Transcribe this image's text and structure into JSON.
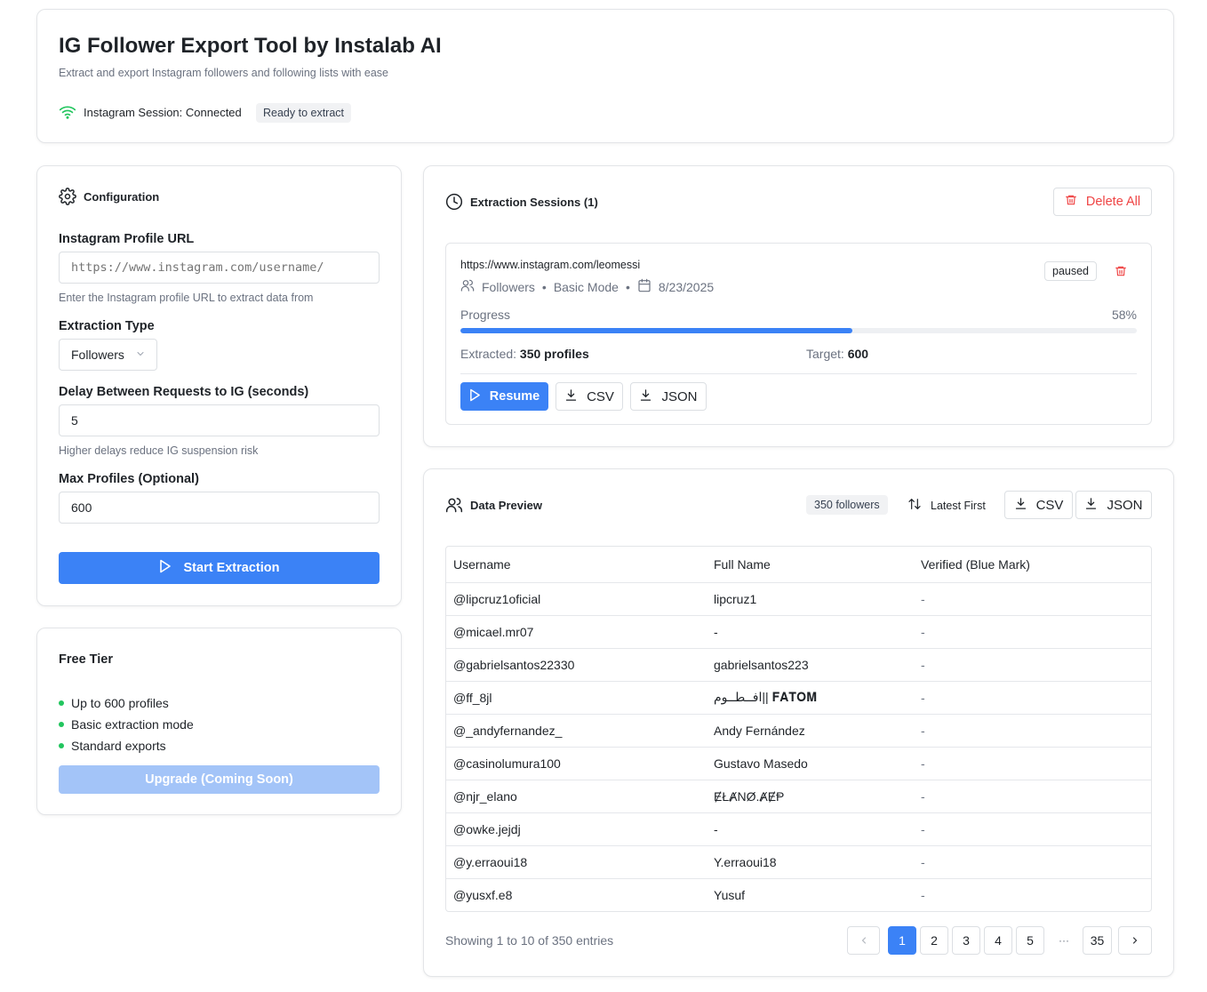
{
  "header": {
    "title": "IG Follower Export Tool by Instalab AI",
    "subtitle": "Extract and export Instagram followers and following lists with ease",
    "session_status": "Instagram Session: Connected",
    "ready_badge": "Ready to extract",
    "status_color": "#22c55e"
  },
  "config": {
    "title": "Configuration",
    "url_label": "Instagram Profile URL",
    "url_placeholder": "https://www.instagram.com/username/",
    "url_help": "Enter the Instagram profile URL to extract data from",
    "type_label": "Extraction Type",
    "type_value": "Followers",
    "delay_label": "Delay Between Requests to IG (seconds)",
    "delay_value": "5",
    "delay_help": "Higher delays reduce IG suspension risk",
    "max_label": "Max Profiles (Optional)",
    "max_value": "600",
    "start_button": "Start Extraction",
    "accent": "#3b82f6"
  },
  "free_tier": {
    "title": "Free Tier",
    "features": [
      "Up to 600 profiles",
      "Basic extraction mode",
      "Standard exports"
    ],
    "upgrade_button": "Upgrade (Coming Soon)"
  },
  "sessions": {
    "title": "Extraction Sessions (1)",
    "delete_all": "Delete All",
    "item": {
      "url": "https://www.instagram.com/leomessi",
      "type": "Followers",
      "mode": "Basic Mode",
      "date": "8/23/2025",
      "status": "paused",
      "progress_label": "Progress",
      "progress_percent": "58%",
      "progress_value": 0.58,
      "extracted_label": "Extracted:",
      "extracted_value": "350 profiles",
      "target_label": "Target:",
      "target_value": "600",
      "resume_button": "Resume",
      "csv_button": "CSV",
      "json_button": "JSON"
    }
  },
  "preview": {
    "title": "Data Preview",
    "count_badge": "350 followers",
    "sort_label": "Latest First",
    "csv_button": "CSV",
    "json_button": "JSON",
    "columns": [
      "Username",
      "Full Name",
      "Verified (Blue Mark)"
    ],
    "rows": [
      [
        "@lipcruz1oficial",
        "lipcruz1",
        "-"
      ],
      [
        "@micael.mr07",
        "-",
        "-"
      ],
      [
        "@gabrielsantos22330",
        "gabrielsantos223",
        "-"
      ],
      [
        "@ff_8jl",
        "افــطــوم|| 𝐅𝐀𝐓𝐎𝐌",
        "-"
      ],
      [
        "@_andyfernandez_",
        "Andy Fernández",
        "-"
      ],
      [
        "@casinolumura100",
        "Gustavo Masedo",
        "-"
      ],
      [
        "@njr_elano",
        "ɆŁȺNØ.ȺɆⱣ",
        "-"
      ],
      [
        "@owke.jejdj",
        "-",
        "-"
      ],
      [
        "@y.erraoui18",
        "Y.erraoui18",
        "-"
      ],
      [
        "@yusxf.e8",
        "Yusuf",
        "-"
      ]
    ],
    "showing": "Showing 1 to 10 of 350 entries",
    "pages": [
      "1",
      "2",
      "3",
      "4",
      "5",
      "···",
      "35"
    ]
  }
}
